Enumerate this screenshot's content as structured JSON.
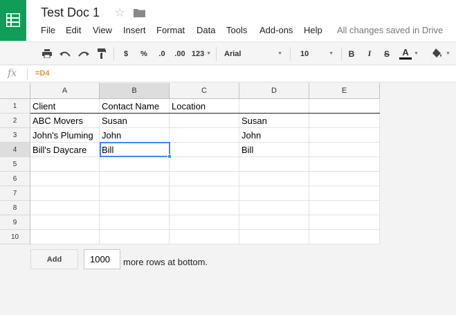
{
  "header": {
    "doc_title": "Test Doc 1",
    "save_status": "All changes saved in Drive"
  },
  "menu": [
    "File",
    "Edit",
    "View",
    "Insert",
    "Format",
    "Data",
    "Tools",
    "Add-ons",
    "Help"
  ],
  "toolbar": {
    "currency": "$",
    "percent": "%",
    "decrease_decimals": ".0",
    "increase_decimals": ".00",
    "more_formats": "123",
    "font": "Arial",
    "font_size": "10",
    "bold": "B",
    "italic": "I",
    "strikethrough": "S",
    "text_color_letter": "A"
  },
  "formula_bar": {
    "fx_label": "fx",
    "value": "=D4"
  },
  "grid": {
    "columns": [
      "A",
      "B",
      "C",
      "D",
      "E"
    ],
    "row_numbers": [
      "1",
      "2",
      "3",
      "4",
      "5",
      "6",
      "7",
      "8",
      "9",
      "10"
    ],
    "cells": [
      [
        "Client",
        "Contact Name",
        "Location",
        "",
        ""
      ],
      [
        "ABC Movers",
        "Susan",
        "",
        "Susan",
        ""
      ],
      [
        "John's Pluming",
        "John",
        "",
        "John",
        ""
      ],
      [
        "Bill's Daycare",
        "Bill",
        "",
        "Bill",
        ""
      ],
      [
        "",
        "",
        "",
        "",
        ""
      ],
      [
        "",
        "",
        "",
        "",
        ""
      ],
      [
        "",
        "",
        "",
        "",
        ""
      ],
      [
        "",
        "",
        "",
        "",
        ""
      ],
      [
        "",
        "",
        "",
        "",
        ""
      ],
      [
        "",
        "",
        "",
        "",
        ""
      ]
    ],
    "selected_cell": "B4"
  },
  "footer": {
    "add_label": "Add",
    "rows_value": "1000",
    "rows_label": "more rows at bottom."
  },
  "colors": {
    "brand_green": "#0f9d58",
    "selection_blue": "#4285f4",
    "formula_orange": "#e69138"
  }
}
